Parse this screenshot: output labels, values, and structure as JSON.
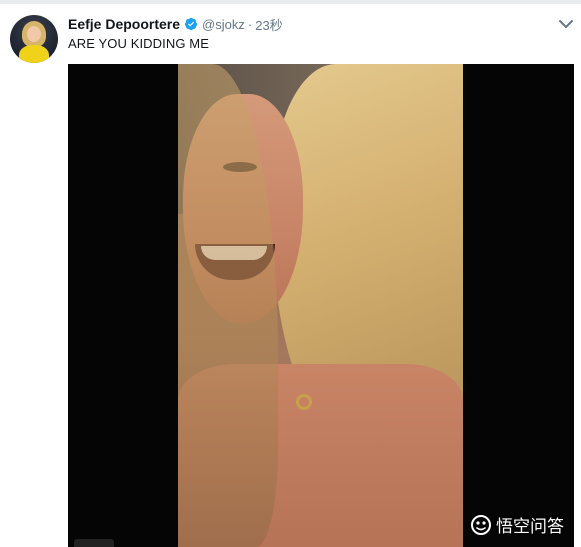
{
  "tweet": {
    "display_name": "Eefje Depoortere",
    "handle": "@sjokz",
    "separator": "·",
    "timestamp": "23秒",
    "text": "ARE YOU KIDDING ME"
  },
  "icons": {
    "verified": "verified-badge-icon",
    "caret": "chevron-down-icon",
    "watermark_logo": "wukong-logo-icon"
  },
  "colors": {
    "name": "#14171a",
    "secondary_text": "#657786",
    "verified_blue": "#1da1f2",
    "media_background": "#050505"
  },
  "watermark": {
    "text": "悟空问答"
  }
}
